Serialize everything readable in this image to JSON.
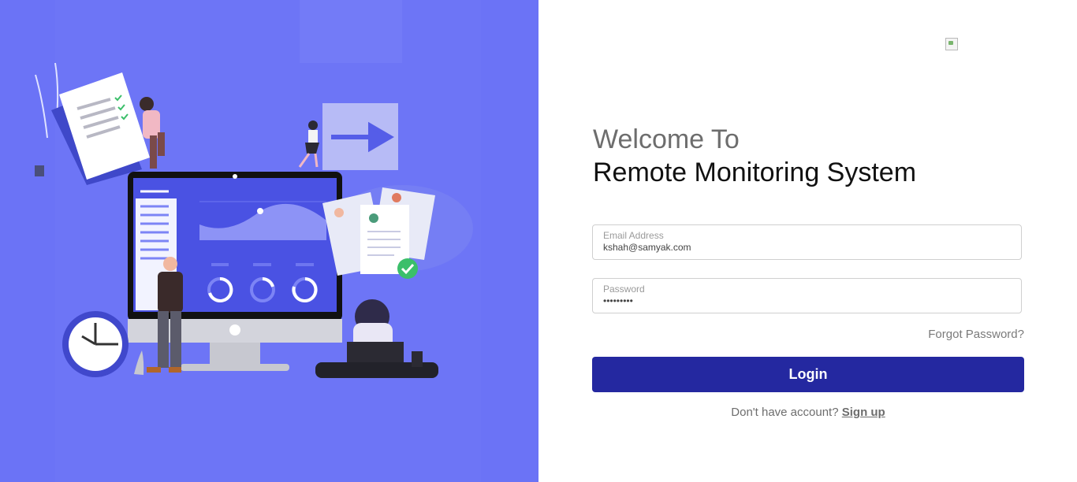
{
  "hero": {
    "illustration": "remote-monitoring-workspace-illustration",
    "background_color": "#6b73f6"
  },
  "brand": {
    "logo_icon": "broken-image-icon"
  },
  "welcome": {
    "line1": "Welcome To",
    "line2": "Remote Monitoring System"
  },
  "form": {
    "email": {
      "label": "Email Address",
      "value": "kshah@samyak.com"
    },
    "password": {
      "label": "Password",
      "value": "•••••••••"
    },
    "forgot_password": "Forgot Password?",
    "login_label": "Login",
    "login_color": "#2428a0",
    "signup_prompt": "Don't have account?",
    "signup_link": "Sign up"
  }
}
